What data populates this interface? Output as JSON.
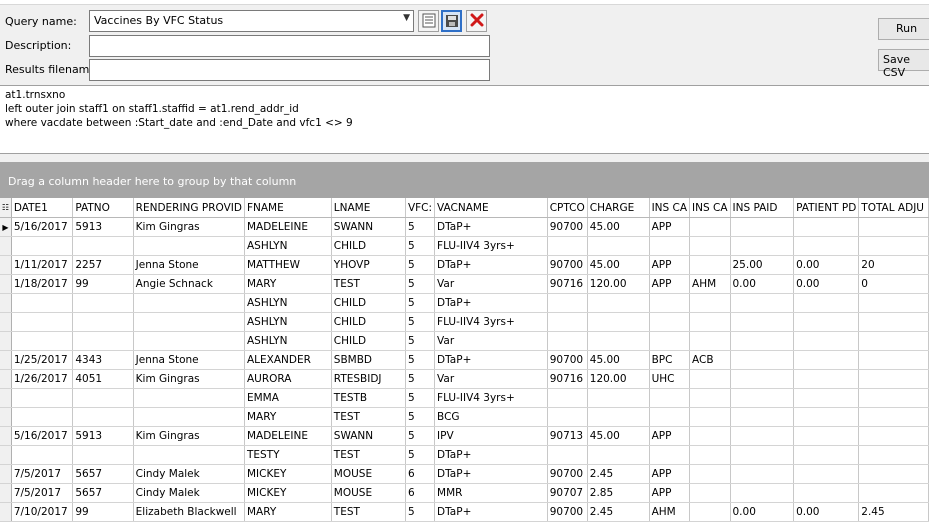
{
  "query": {
    "name_label": "Query name:",
    "name_value": "Vaccines By VFC Status",
    "description_label": "Description:",
    "description_value": "",
    "results_label": "Results filename:",
    "results_value": ""
  },
  "actions": {
    "run_label": "Run",
    "save_csv_label": "Save CSV"
  },
  "toolbar_icons": [
    "list-icon",
    "save-icon",
    "delete-icon"
  ],
  "sql_lines": [
    "at1.trnsxno",
    "left outer join staff1 on staff1.staffid = at1.rend_addr_id",
    "where vacdate between :Start_date and :end_Date and vfc1 <> 9"
  ],
  "group_hint": "Drag a column header here to group by that column",
  "grid": {
    "columns": [
      "DATE1",
      "PATNO",
      "RENDERING PROVID",
      "FNAME",
      "LNAME",
      "VFC:",
      "VACNAME",
      "CPTCO",
      "CHARGE",
      "INS CA",
      "INS CA",
      "INS PAID",
      "PATIENT PD",
      "TOTAL ADJU"
    ],
    "rows": [
      [
        "5/16/2017",
        "5913",
        "Kim  Gingras",
        "MADELEINE",
        "SWANN",
        "5",
        "DTaP+",
        "90700",
        "45.00",
        "APP",
        "",
        "",
        "",
        ""
      ],
      [
        "",
        "",
        "",
        "ASHLYN",
        "CHILD",
        "5",
        "FLU-IIV4 3yrs+",
        "",
        "",
        "",
        "",
        "",
        "",
        ""
      ],
      [
        "1/11/2017",
        "2257",
        "Jenna Stone",
        "MATTHEW",
        "YHOVP",
        "5",
        "DTaP+",
        "90700",
        "45.00",
        "APP",
        "",
        "25.00",
        "0.00",
        "20"
      ],
      [
        "1/18/2017",
        "99",
        "Angie Schnack",
        "MARY",
        "TEST",
        "5",
        "Var",
        "90716",
        "120.00",
        "APP",
        "AHM",
        "0.00",
        "0.00",
        "0"
      ],
      [
        "",
        "",
        "",
        "ASHLYN",
        "CHILD",
        "5",
        "DTaP+",
        "",
        "",
        "",
        "",
        "",
        "",
        ""
      ],
      [
        "",
        "",
        "",
        "ASHLYN",
        "CHILD",
        "5",
        "FLU-IIV4 3yrs+",
        "",
        "",
        "",
        "",
        "",
        "",
        ""
      ],
      [
        "",
        "",
        "",
        "ASHLYN",
        "CHILD",
        "5",
        "Var",
        "",
        "",
        "",
        "",
        "",
        "",
        ""
      ],
      [
        "1/25/2017",
        "4343",
        "Jenna Stone",
        "ALEXANDER",
        "SBMBD",
        "5",
        "DTaP+",
        "90700",
        "45.00",
        "BPC",
        "ACB",
        "",
        "",
        ""
      ],
      [
        "1/26/2017",
        "4051",
        "Kim  Gingras",
        "AURORA",
        "RTESBIDJ",
        "5",
        "Var",
        "90716",
        "120.00",
        "UHC",
        "",
        "",
        "",
        ""
      ],
      [
        "",
        "",
        "",
        "EMMA",
        "TESTB",
        "5",
        "FLU-IIV4 3yrs+",
        "",
        "",
        "",
        "",
        "",
        "",
        ""
      ],
      [
        "",
        "",
        "",
        "MARY",
        "TEST",
        "5",
        "BCG",
        "",
        "",
        "",
        "",
        "",
        "",
        ""
      ],
      [
        "5/16/2017",
        "5913",
        "Kim  Gingras",
        "MADELEINE",
        "SWANN",
        "5",
        "IPV",
        "90713",
        "45.00",
        "APP",
        "",
        "",
        "",
        ""
      ],
      [
        "",
        "",
        "",
        "TESTY",
        "TEST",
        "5",
        "DTaP+",
        "",
        "",
        "",
        "",
        "",
        "",
        ""
      ],
      [
        "7/5/2017",
        "5657",
        "Cindy Malek",
        "MICKEY",
        "MOUSE",
        "6",
        "DTaP+",
        "90700",
        "2.45",
        "APP",
        "",
        "",
        "",
        ""
      ],
      [
        "7/5/2017",
        "5657",
        "Cindy Malek",
        "MICKEY",
        "MOUSE",
        "6",
        "MMR",
        "90707",
        "2.85",
        "APP",
        "",
        "",
        "",
        ""
      ],
      [
        "7/10/2017",
        "99",
        "Elizabeth Blackwell",
        "MARY",
        "TEST",
        "5",
        "DTaP+",
        "90700",
        "2.45",
        "AHM",
        "",
        "0.00",
        "0.00",
        "2.45"
      ]
    ]
  }
}
